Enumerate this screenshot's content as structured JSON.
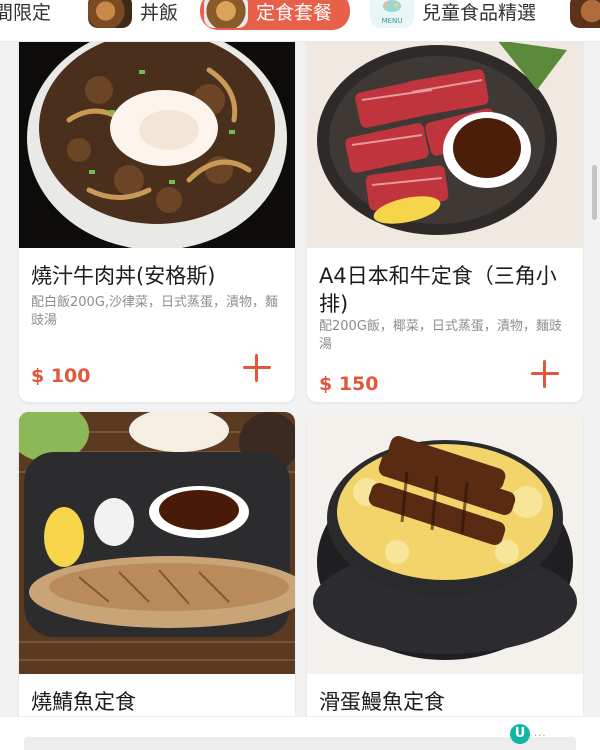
{
  "categories": [
    {
      "label": "間限定",
      "icon": "food-thumbnail",
      "active": false
    },
    {
      "label": "丼飯",
      "icon": "food-thumbnail",
      "active": false
    },
    {
      "label": "定食套餐",
      "icon": "food-thumbnail",
      "active": true
    },
    {
      "label": "兒童食品精選",
      "icon": "menu-thumbnail",
      "active": false
    }
  ],
  "menu_thumb_text": "MENU",
  "items": [
    {
      "name": "燒汁牛肉丼(安格斯)",
      "desc": "配白飯200G,沙律菜，日式蒸蛋，漬物，麵豉湯",
      "price": "$ 100"
    },
    {
      "name": "A4日本和牛定食（三角小排)",
      "desc": "配200G飯，椰菜，日式蒸蛋，漬物，麵豉湯",
      "price": "$ 150"
    },
    {
      "name": "燒鯖魚定食",
      "desc": "",
      "price": ""
    },
    {
      "name": "滑蛋鰻魚定食",
      "desc": "",
      "price": ""
    }
  ],
  "watermark": {
    "letter": "U",
    "dots": "..."
  },
  "colors": {
    "accent": "#e2573c",
    "active_tab": "#e8604a",
    "background": "#f2f2f2"
  }
}
